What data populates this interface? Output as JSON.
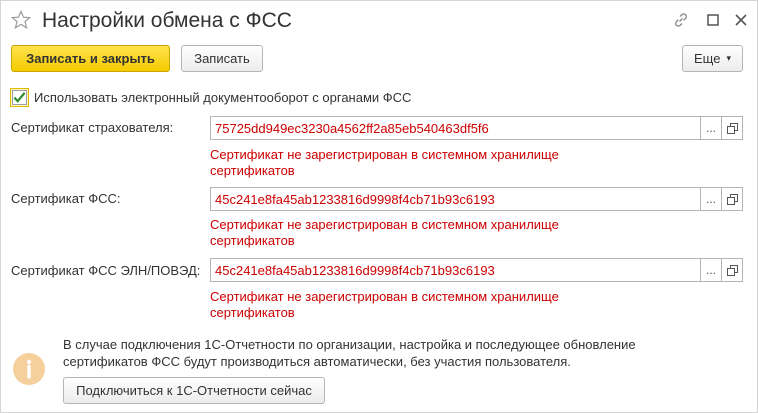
{
  "window": {
    "title": "Настройки обмена с ФСС",
    "controls": [
      "link-icon",
      "maximize-icon",
      "close-icon"
    ]
  },
  "toolbar": {
    "save_close_label": "Записать и закрыть",
    "save_label": "Записать",
    "more_label": "Еще",
    "more_arrow": "▾"
  },
  "edo": {
    "checked": true,
    "label": "Использовать электронный документооборот с органами ФСС"
  },
  "certs": [
    {
      "label": "Сертификат страхователя:",
      "value": "75725dd949ec3230a4562ff2a85eb540463df5f6",
      "error": "Сертификат не зарегистрирован в системном хранилище сертификатов"
    },
    {
      "label": "Сертификат ФСС:",
      "value": "45c241e8fa45ab1233816d9998f4cb71b93c6193",
      "error": "Сертификат не зарегистрирован в системном хранилище сертификатов"
    },
    {
      "label": "Сертификат ФСС ЭЛН/ПОВЭД:",
      "value": "45c241e8fa45ab1233816d9998f4cb71b93c6193",
      "error": "Сертификат не зарегистрирован в системном хранилище сертификатов"
    }
  ],
  "field_buttons": {
    "choose": "...",
    "open_icon": "open-icon"
  },
  "info": {
    "text": "В случае подключения 1С-Отчетности по организации, настройка и последующее обновление сертификатов ФСС будут производиться автоматически, без участия пользователя.",
    "connect_label": "Подключиться к 1С-Отчетности сейчас"
  },
  "colors": {
    "accent_yellow": "#f5cc00",
    "error_red": "#cc0000",
    "info_orange": "#f5cf9c"
  }
}
